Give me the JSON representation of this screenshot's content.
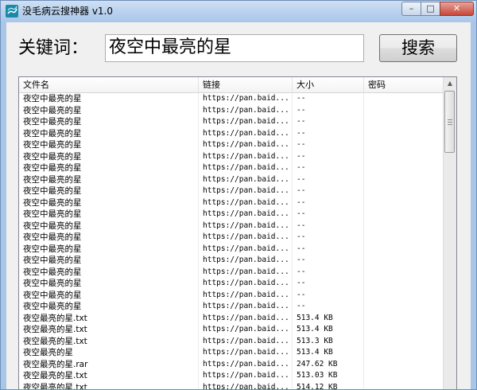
{
  "window": {
    "title": "没毛病云搜神器 v1.0",
    "controls": {
      "minimize": "–",
      "maximize": "□",
      "close": "✕"
    }
  },
  "search": {
    "label": "关键词：",
    "value": "夜空中最亮的星",
    "button": "搜索"
  },
  "table": {
    "columns": [
      "文件名",
      "链接",
      "大小",
      "密码"
    ],
    "rows": [
      {
        "name": "夜空中最亮的星",
        "link": "https://pan.baid...",
        "size": "--",
        "password": ""
      },
      {
        "name": "夜空中最亮的星",
        "link": "https://pan.baid...",
        "size": "--",
        "password": ""
      },
      {
        "name": "夜空中最亮的星",
        "link": "https://pan.baid...",
        "size": "--",
        "password": ""
      },
      {
        "name": "夜空中最亮的星",
        "link": "https://pan.baid...",
        "size": "--",
        "password": ""
      },
      {
        "name": "夜空中最亮的星",
        "link": "https://pan.baid...",
        "size": "--",
        "password": ""
      },
      {
        "name": "夜空中最亮的星",
        "link": "https://pan.baid...",
        "size": "--",
        "password": ""
      },
      {
        "name": "夜空中最亮的星",
        "link": "https://pan.baid...",
        "size": "--",
        "password": ""
      },
      {
        "name": "夜空中最亮的星",
        "link": "https://pan.baid...",
        "size": "--",
        "password": ""
      },
      {
        "name": "夜空中最亮的星",
        "link": "https://pan.baid...",
        "size": "--",
        "password": ""
      },
      {
        "name": "夜空中最亮的星",
        "link": "https://pan.baid...",
        "size": "--",
        "password": ""
      },
      {
        "name": "夜空中最亮的星",
        "link": "https://pan.baid...",
        "size": "--",
        "password": ""
      },
      {
        "name": "夜空中最亮的星",
        "link": "https://pan.baid...",
        "size": "--",
        "password": ""
      },
      {
        "name": "夜空中最亮的星",
        "link": "https://pan.baid...",
        "size": "--",
        "password": ""
      },
      {
        "name": "夜空中最亮的星",
        "link": "https://pan.baid...",
        "size": "--",
        "password": ""
      },
      {
        "name": "夜空中最亮的星",
        "link": "https://pan.baid...",
        "size": "--",
        "password": ""
      },
      {
        "name": "夜空中最亮的星",
        "link": "https://pan.baid...",
        "size": "--",
        "password": ""
      },
      {
        "name": "夜空中最亮的星",
        "link": "https://pan.baid...",
        "size": "--",
        "password": ""
      },
      {
        "name": "夜空中最亮的星",
        "link": "https://pan.baid...",
        "size": "--",
        "password": ""
      },
      {
        "name": "夜空中最亮的星",
        "link": "https://pan.baid...",
        "size": "--",
        "password": ""
      },
      {
        "name": "夜空最亮的星.txt",
        "link": "https://pan.baid...",
        "size": "513.4 KB",
        "password": ""
      },
      {
        "name": "夜空最亮的星.txt",
        "link": "https://pan.baid...",
        "size": "513.4 KB",
        "password": ""
      },
      {
        "name": "夜空最亮的星.txt",
        "link": "https://pan.baid...",
        "size": "513.3 KB",
        "password": ""
      },
      {
        "name": "夜空最亮的星",
        "link": "https://pan.baid...",
        "size": "513.4 KB",
        "password": ""
      },
      {
        "name": "夜空最亮的星.rar",
        "link": "https://pan.baid...",
        "size": "247.62 KB",
        "password": ""
      },
      {
        "name": "夜空最亮的星.txt",
        "link": "https://pan.baid...",
        "size": "513.03 KB",
        "password": ""
      },
      {
        "name": "夜空最亮的星.txt",
        "link": "https://pan.baid...",
        "size": "514.12 KB",
        "password": ""
      }
    ]
  },
  "scrollbar": {
    "up": "▲",
    "down": "▼"
  }
}
